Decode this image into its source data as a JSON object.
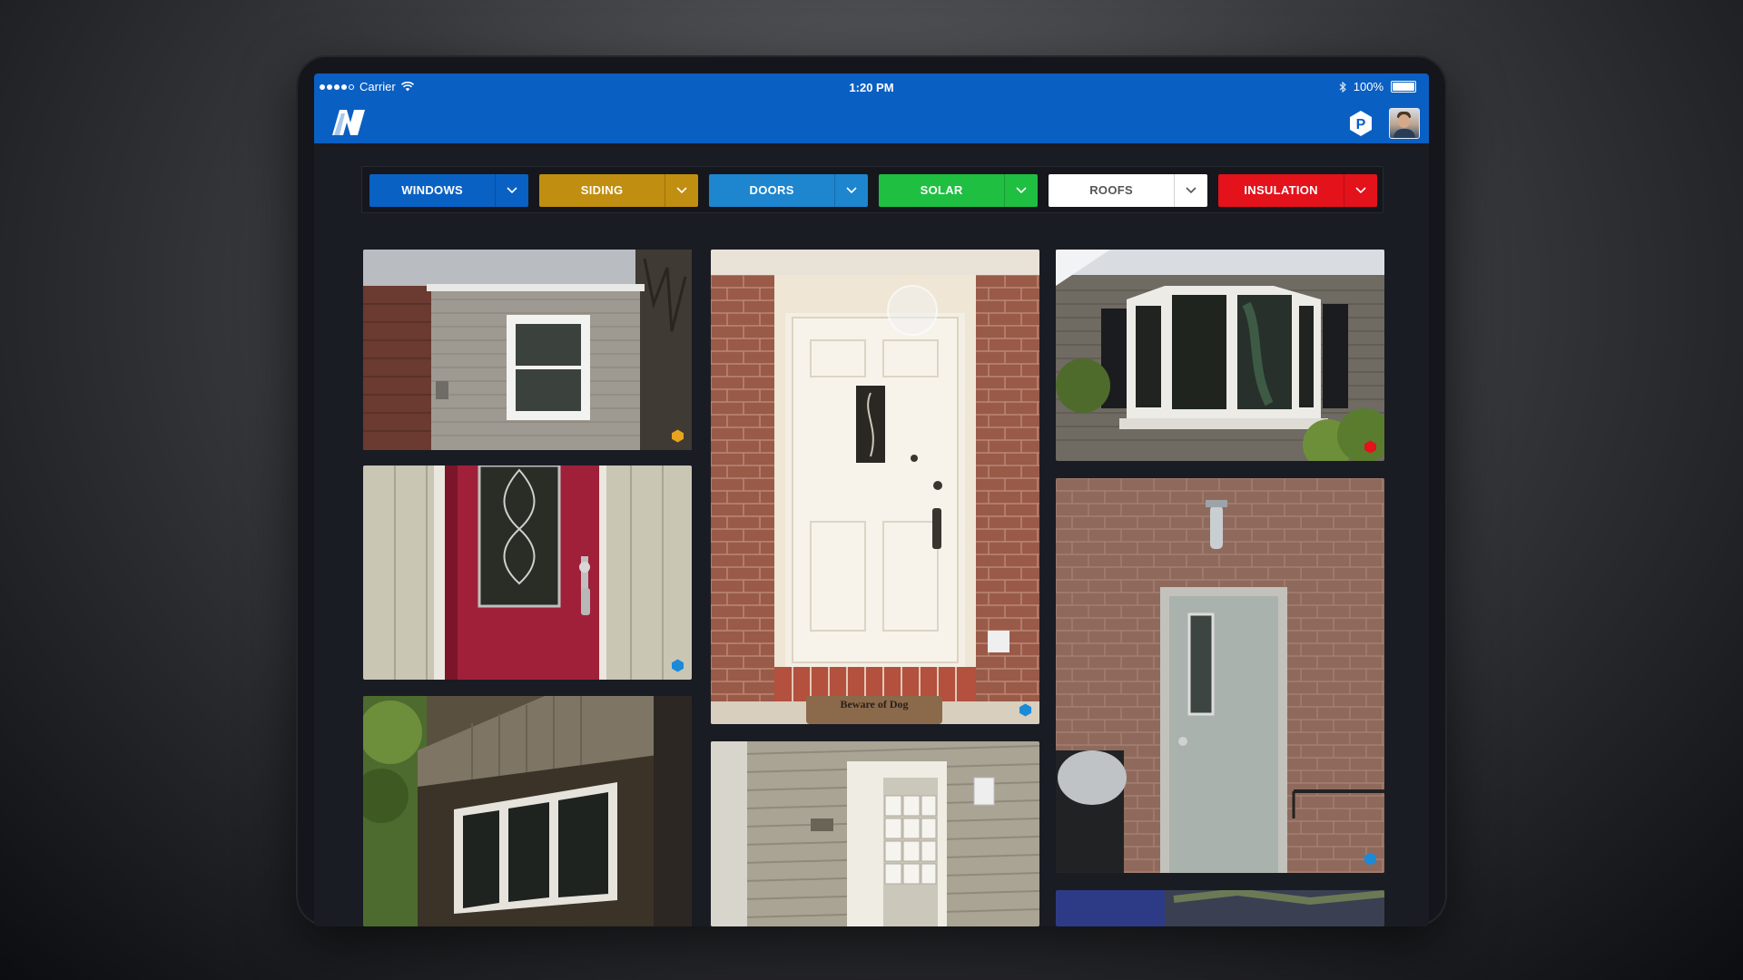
{
  "status_bar": {
    "carrier": "Carrier",
    "time": "1:20 PM",
    "battery_text": "100%",
    "battery_level": 1.0
  },
  "header": {
    "logo_icon": "n-logo-icon",
    "action_icon": "p-badge-icon",
    "avatar_icon": "user-avatar"
  },
  "filters": [
    {
      "label": "WINDOWS",
      "color": "#0a61c4",
      "text_color": "#ffffff"
    },
    {
      "label": "SIDING",
      "color": "#c08e10",
      "text_color": "#ffffff"
    },
    {
      "label": "DOORS",
      "color": "#1d86cf",
      "text_color": "#ffffff"
    },
    {
      "label": "SOLAR",
      "color": "#1fbf42",
      "text_color": "#ffffff"
    },
    {
      "label": "ROOFS",
      "color": "#ffffff",
      "text_color": "#555555"
    },
    {
      "label": "INSULATION",
      "color": "#e3121b",
      "text_color": "#ffffff"
    }
  ],
  "gallery": [
    {
      "name": "siding-house-photo",
      "tag": "siding"
    },
    {
      "name": "red-door-photo",
      "tag": "doors"
    },
    {
      "name": "brown-siding-windows-photo",
      "tag": "none"
    },
    {
      "name": "white-front-door-photo",
      "tag": "doors"
    },
    {
      "name": "beige-siding-door-photo",
      "tag": "none"
    },
    {
      "name": "bay-window-photo",
      "tag": "insulation"
    },
    {
      "name": "gray-door-brick-photo",
      "tag": "doors"
    }
  ],
  "doormat_text": "Beware of Dog",
  "tag_colors": {
    "siding": "#e6a41c",
    "doors": "#1b8ad8",
    "insulation": "#e3121b"
  }
}
